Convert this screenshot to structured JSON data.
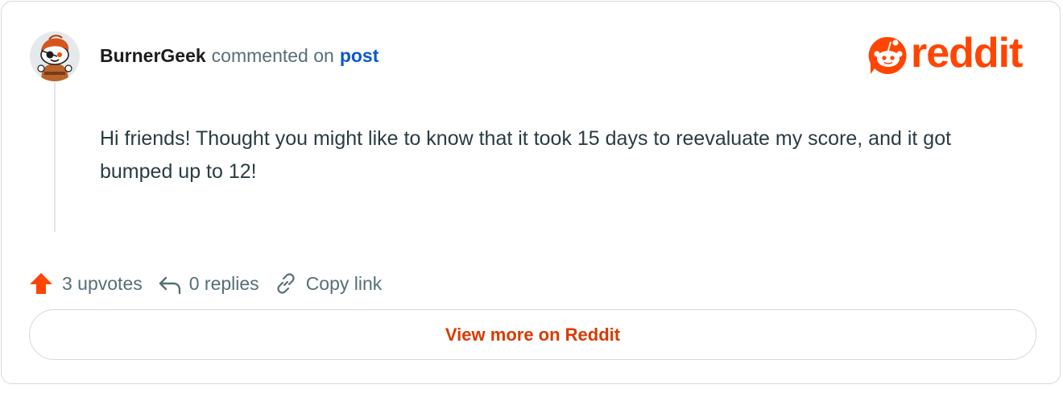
{
  "comment": {
    "author": "BurnerGeek",
    "action_text": "commented on",
    "target_link": "post",
    "body": "Hi friends! Thought you might like to know that it took 15 days to reevaluate my score, and it got bumped up to 12!"
  },
  "brand": {
    "logo_text": "reddit",
    "logo_icon": "reddit-snoo-icon",
    "color": "#ff4500"
  },
  "actions": {
    "upvotes_label": "3 upvotes",
    "replies_label": "0 replies",
    "copy_link_label": "Copy link",
    "upvote_icon": "upvote-arrow-icon",
    "reply_icon": "reply-arrow-icon",
    "link_icon": "link-icon",
    "upvote_color": "#ff4500"
  },
  "footer": {
    "view_more_label": "View more on Reddit",
    "color": "#d93a00"
  }
}
